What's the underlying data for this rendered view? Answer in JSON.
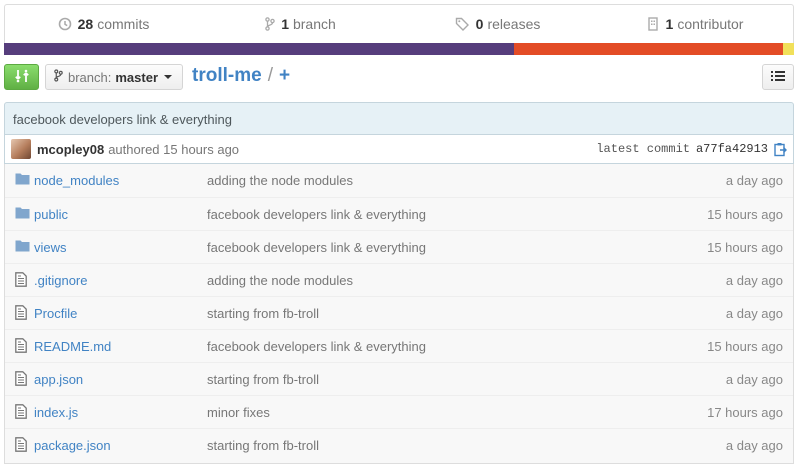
{
  "stats": {
    "commits": {
      "count": "28",
      "label": "commits",
      "icon": "history-icon"
    },
    "branches": {
      "count": "1",
      "label": "branch",
      "icon": "branch-icon"
    },
    "releases": {
      "count": "0",
      "label": "releases",
      "icon": "tag-icon"
    },
    "contributors": {
      "count": "1",
      "label": "contributor",
      "icon": "organization-icon"
    }
  },
  "languages": [
    {
      "color": "#563d7c",
      "percent": 64.5
    },
    {
      "color": "#e34c26",
      "percent": 34.1
    },
    {
      "color": "#f1e05a",
      "percent": 1.4
    }
  ],
  "toolbar": {
    "branch_label": "branch:",
    "branch_value": "master",
    "repo_name": "troll-me",
    "separator": "/",
    "plus": "+"
  },
  "commit": {
    "message": "facebook developers link & everything",
    "author": "mcopley08",
    "authored": "authored 15 hours ago",
    "latest_label": "latest commit",
    "sha": "a77fa42913"
  },
  "files": [
    {
      "type": "dir",
      "name": "node_modules",
      "message": "adding the node modules",
      "age": "a day ago"
    },
    {
      "type": "dir",
      "name": "public",
      "message": "facebook developers link & everything",
      "age": "15 hours ago"
    },
    {
      "type": "dir",
      "name": "views",
      "message": "facebook developers link & everything",
      "age": "15 hours ago"
    },
    {
      "type": "file",
      "name": ".gitignore",
      "message": "adding the node modules",
      "age": "a day ago"
    },
    {
      "type": "file",
      "name": "Procfile",
      "message": "starting from fb-troll",
      "age": "a day ago"
    },
    {
      "type": "file",
      "name": "README.md",
      "message": "facebook developers link & everything",
      "age": "15 hours ago"
    },
    {
      "type": "file",
      "name": "app.json",
      "message": "starting from fb-troll",
      "age": "a day ago"
    },
    {
      "type": "file",
      "name": "index.js",
      "message": "minor fixes",
      "age": "17 hours ago"
    },
    {
      "type": "file",
      "name": "package.json",
      "message": "starting from fb-troll",
      "age": "a day ago"
    }
  ]
}
